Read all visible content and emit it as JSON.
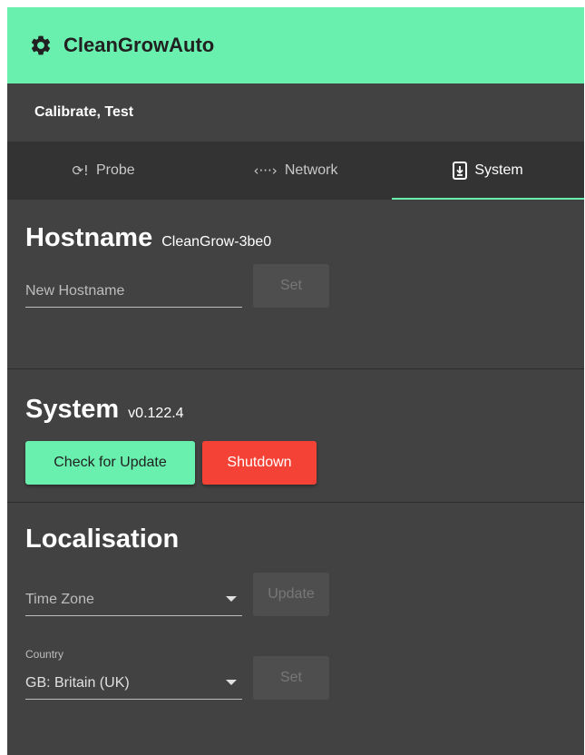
{
  "app": {
    "title": "CleanGrowAuto",
    "brand_color": "#69f0ae",
    "icon": "gear-icon"
  },
  "subheader": {
    "title": "Calibrate, Test"
  },
  "tabs": [
    {
      "label": "Probe",
      "icon": "probe-icon",
      "active": false
    },
    {
      "label": "Network",
      "icon": "network-icon",
      "active": false
    },
    {
      "label": "System",
      "icon": "system-icon",
      "active": true
    }
  ],
  "hostname": {
    "heading": "Hostname",
    "current": "CleanGrow-3be0",
    "input_placeholder": "New Hostname",
    "input_value": "",
    "set_label": "Set"
  },
  "system": {
    "heading": "System",
    "version": "v0.122.4",
    "check_update_label": "Check for Update",
    "shutdown_label": "Shutdown",
    "check_color": "#69f0ae",
    "shutdown_color": "#f44336"
  },
  "localisation": {
    "heading": "Localisation",
    "timezone_placeholder": "Time Zone",
    "update_label": "Update",
    "country_label": "Country",
    "country_value": "GB: Britain (UK)",
    "set_label": "Set"
  }
}
